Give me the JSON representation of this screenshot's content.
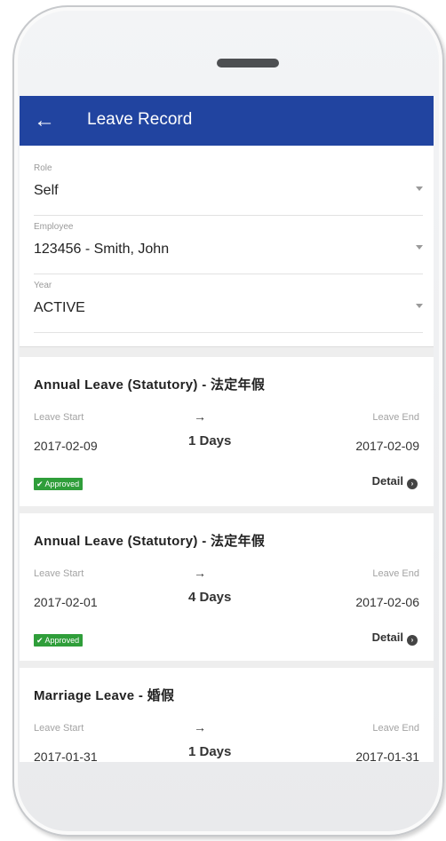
{
  "appbar": {
    "title": "Leave Record",
    "back_icon": "arrow-left-icon",
    "color": "#2144a0"
  },
  "filters": [
    {
      "label": "Role",
      "value": "Self"
    },
    {
      "label": "Employee",
      "value": "123456 - Smith, John"
    },
    {
      "label": "Year",
      "value": "ACTIVE"
    }
  ],
  "records": [
    {
      "title": "Annual Leave (Statutory) - 法定年假",
      "start_label": "Leave Start",
      "start_date": "2017-02-09",
      "arrow": "→",
      "duration": "1 Days",
      "end_label": "Leave End",
      "end_date": "2017-02-09",
      "status": "Approved",
      "detail_label": "Detail"
    },
    {
      "title": "Annual Leave (Statutory) - 法定年假",
      "start_label": "Leave Start",
      "start_date": "2017-02-01",
      "arrow": "→",
      "duration": "4 Days",
      "end_label": "Leave End",
      "end_date": "2017-02-06",
      "status": "Approved",
      "detail_label": "Detail"
    },
    {
      "title": "Marriage Leave - 婚假",
      "start_label": "Leave Start",
      "start_date": "2017-01-31",
      "arrow": "→",
      "duration": "1 Days",
      "end_label": "Leave End",
      "end_date": "2017-01-31"
    }
  ],
  "colors": {
    "status_approved": "#2f9e3a"
  }
}
